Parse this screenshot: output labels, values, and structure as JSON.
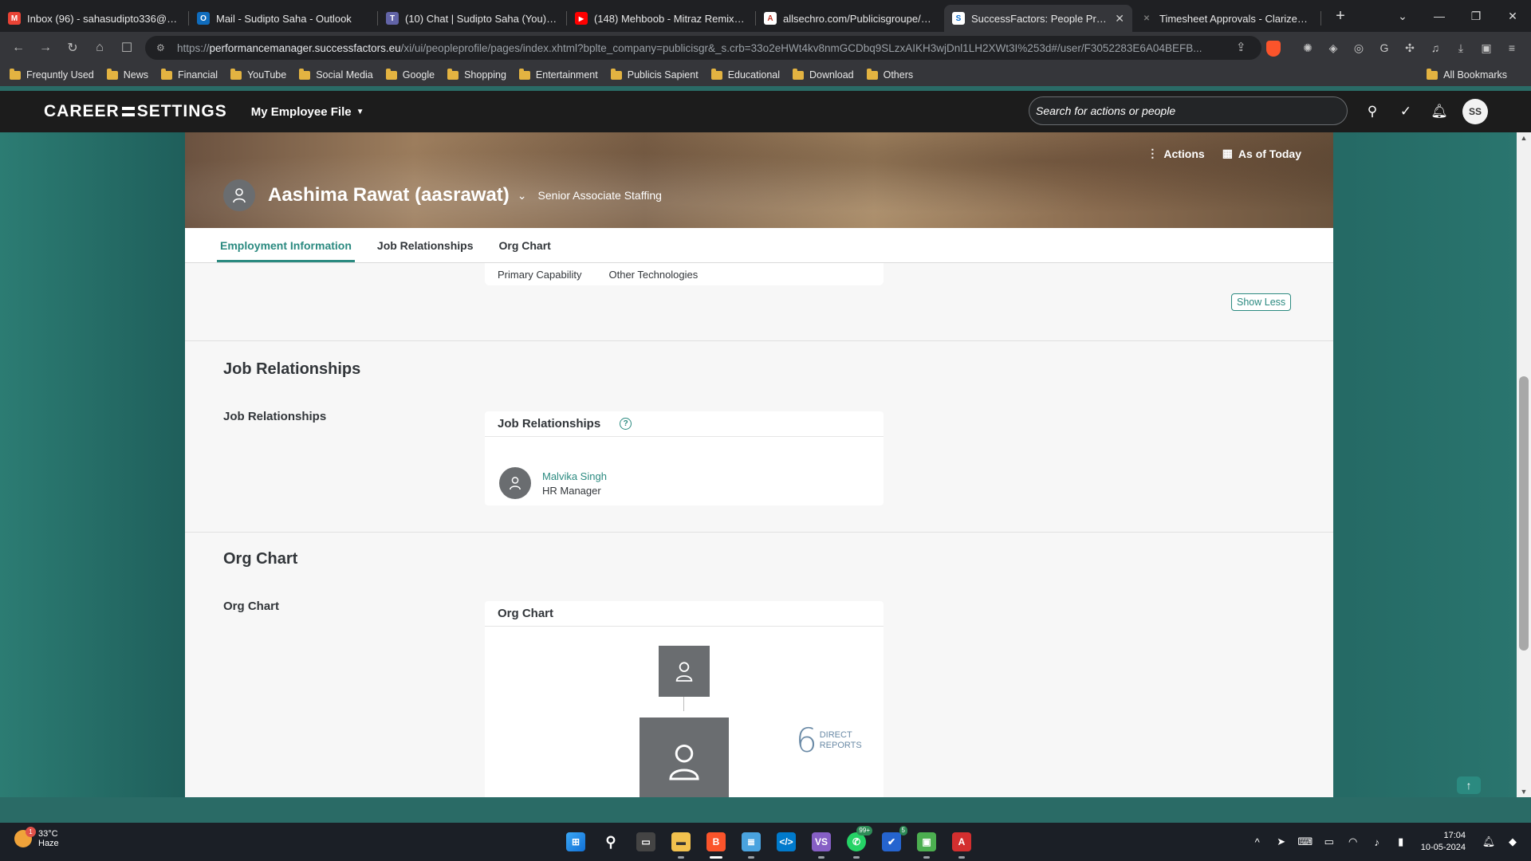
{
  "browser": {
    "tabs": [
      {
        "title": "Inbox (96) - sahasudipto336@gmail.com",
        "icon": "gmail-icon",
        "color": "#ea4335",
        "glyph": "M"
      },
      {
        "title": "Mail - Sudipto Saha - Outlook",
        "icon": "outlook-icon",
        "color": "#0f6cbd",
        "glyph": "O"
      },
      {
        "title": "(10) Chat | Sudipto Saha (You) | Microsoft Teams",
        "icon": "teams-icon",
        "color": "#6264a7",
        "glyph": "T"
      },
      {
        "title": "(148) Mehboob - Mitraz Remix | YouTube",
        "icon": "youtube-icon",
        "color": "#ff0000",
        "glyph": "▶"
      },
      {
        "title": "allsechro.com/Publicisgroupe/comm",
        "icon": "allsec-icon",
        "color": "#c0392b",
        "glyph": "A"
      },
      {
        "title": "SuccessFactors: People Profile",
        "icon": "successfactors-icon",
        "color": "#0a6ed1",
        "glyph": "S"
      },
      {
        "title": "Timesheet Approvals - Clarizen.com",
        "icon": "clarizen-icon",
        "color": "#1f2023",
        "glyph": "✕"
      }
    ],
    "active_tab": 5,
    "url_scheme": "https://",
    "url_host": "performancemanager.successfactors.eu",
    "url_path": "/xi/ui/peopleprofile/pages/index.xhtml?bplte_company=publicisgr&_s.crb=33o2eHWt4kv8nmGCDbq9SLzxAIKH3wjDnl1LH2XWt3I%253d#/user/F3052283E6A04BEFB...",
    "bookmarks": [
      "Frequntly Used",
      "News",
      "Financial",
      "YouTube",
      "Social Media",
      "Google",
      "Shopping",
      "Entertainment",
      "Publicis Sapient",
      "Educational",
      "Download",
      "Others"
    ],
    "all_bookmarks": "All Bookmarks"
  },
  "app": {
    "logo_left": "CAREER",
    "logo_right": "SETTINGS",
    "menu": "My Employee File",
    "search_placeholder": "Search for actions or people",
    "user_initials": "SS"
  },
  "profile": {
    "name": "Aashima Rawat (aasrawat)",
    "title": "Senior Associate Staffing",
    "actions": "Actions",
    "as_of": "As of Today",
    "tabs": [
      "Employment Information",
      "Job Relationships",
      "Org Chart"
    ],
    "active_tab": 0
  },
  "capabilities": {
    "primary": "Primary Capability",
    "other": "Other Technologies",
    "show_less": "Show Less"
  },
  "job_relationships": {
    "section_title": "Job Relationships",
    "label": "Job Relationships",
    "card_title": "Job Relationships",
    "person_name": "Malvika Singh",
    "person_role": "HR Manager"
  },
  "org_chart": {
    "section_title": "Org Chart",
    "label": "Org Chart",
    "card_title": "Org Chart",
    "direct_reports": "6",
    "direct_label_1": "DIRECT",
    "direct_label_2": "REPORTS"
  },
  "taskbar": {
    "temperature": "33°C",
    "weather": "Haze",
    "weather_badge": "1",
    "whatsapp_count": "99+",
    "todo_count": "5",
    "time": "17:04",
    "date": "10-05-2024"
  }
}
